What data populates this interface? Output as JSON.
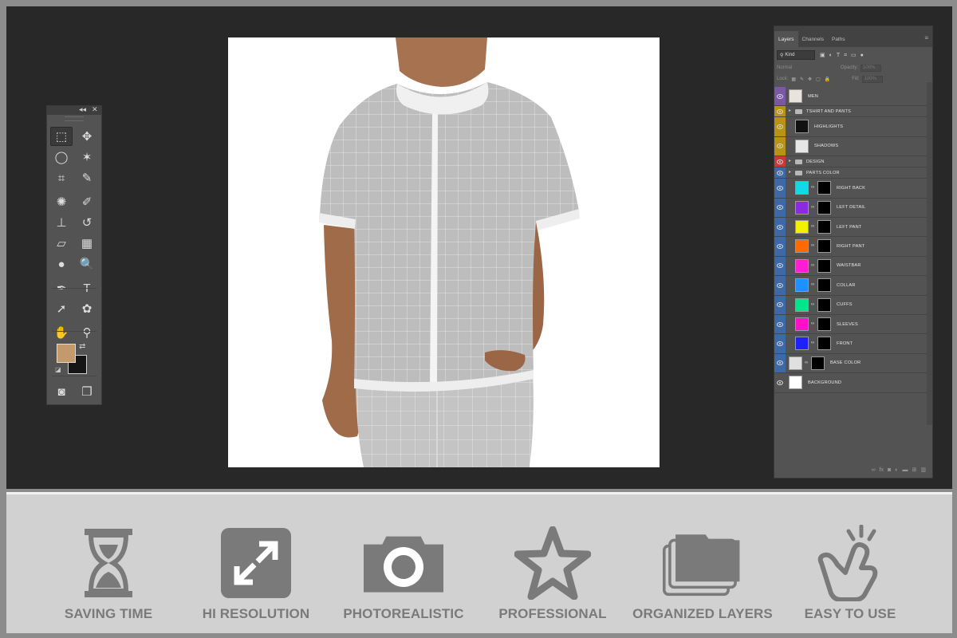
{
  "tools_panel": {
    "collapse_label": "◂◂",
    "close_label": "✕",
    "tools": [
      {
        "name": "rectangular-marquee-tool",
        "glyph": "⬚"
      },
      {
        "name": "move-tool",
        "glyph": "✥"
      },
      {
        "name": "lasso-tool",
        "glyph": "◯"
      },
      {
        "name": "magic-wand-tool",
        "glyph": "✶"
      },
      {
        "name": "crop-tool",
        "glyph": "⌗"
      },
      {
        "name": "eyedropper-tool",
        "glyph": "✎"
      },
      {
        "name": "healing-brush-tool",
        "glyph": "✺"
      },
      {
        "name": "brush-tool",
        "glyph": "✐"
      },
      {
        "name": "clone-stamp-tool",
        "glyph": "⊥"
      },
      {
        "name": "history-brush-tool",
        "glyph": "↺"
      },
      {
        "name": "eraser-tool",
        "glyph": "▱"
      },
      {
        "name": "gradient-tool",
        "glyph": "▦"
      },
      {
        "name": "blur-tool",
        "glyph": "●"
      },
      {
        "name": "dodge-tool",
        "glyph": "🔍"
      },
      {
        "name": "pen-tool",
        "glyph": "✒"
      },
      {
        "name": "type-tool",
        "glyph": "T"
      },
      {
        "name": "path-selection-tool",
        "glyph": "➚"
      },
      {
        "name": "custom-shape-tool",
        "glyph": "✿"
      },
      {
        "name": "hand-tool",
        "glyph": "✋"
      },
      {
        "name": "zoom-tool",
        "glyph": "⚲"
      },
      {
        "name": "quick-mask-button",
        "glyph": "◙"
      },
      {
        "name": "screen-mode-button",
        "glyph": "❐"
      }
    ],
    "foreground_color": "#c49a6c",
    "background_color": "#151515"
  },
  "layers_panel": {
    "tabs": [
      "Layers",
      "Channels",
      "Paths"
    ],
    "filter_kind": "Kind",
    "blend_mode": "Normal",
    "opacity_label": "Opacity:",
    "opacity_value": "100%",
    "lock_label": "Lock:",
    "fill_label": "Fill:",
    "fill_value": "100%",
    "layers": [
      {
        "name": "MEN",
        "type": "layer",
        "indent": 0,
        "color": "#7a58a6",
        "thumb": "#e8e3dd",
        "mask": false,
        "visible": true
      },
      {
        "name": "TSHIRT AND PANTS",
        "type": "group",
        "indent": 0,
        "color": "#b89413",
        "visible": true
      },
      {
        "name": "HIGHLIGHTS",
        "type": "layer",
        "indent": 1,
        "color": "#b89413",
        "thumb": "#111111",
        "mask": false,
        "visible": true
      },
      {
        "name": "SHADOWS",
        "type": "layer",
        "indent": 1,
        "color": "#b89413",
        "thumb": "#e6e6e6",
        "mask": false,
        "visible": true
      },
      {
        "name": "DESIGN",
        "type": "group",
        "indent": 0,
        "color": "#c83a3a",
        "visible": true
      },
      {
        "name": "PARTS COLOR",
        "type": "group",
        "indent": 0,
        "color": "#3d6aa6",
        "visible": true
      },
      {
        "name": "RIGHT BACK",
        "type": "layer",
        "indent": 1,
        "color": "#3d6aa6",
        "thumb": "#12d9e8",
        "mask": true,
        "visible": true
      },
      {
        "name": "LEFT DETAIL",
        "type": "layer",
        "indent": 1,
        "color": "#3d6aa6",
        "thumb": "#8a2be2",
        "mask": true,
        "visible": true
      },
      {
        "name": "LEFT PANT",
        "type": "layer",
        "indent": 1,
        "color": "#3d6aa6",
        "thumb": "#f2f200",
        "mask": true,
        "visible": true
      },
      {
        "name": "RIGHT PANT",
        "type": "layer",
        "indent": 1,
        "color": "#3d6aa6",
        "thumb": "#ff6a00",
        "mask": true,
        "visible": true
      },
      {
        "name": "WAISTBAR",
        "type": "layer",
        "indent": 1,
        "color": "#3d6aa6",
        "thumb": "#ff1fd0",
        "mask": true,
        "visible": true
      },
      {
        "name": "COLLAR",
        "type": "layer",
        "indent": 1,
        "color": "#3d6aa6",
        "thumb": "#1e90ff",
        "mask": true,
        "visible": true
      },
      {
        "name": "CUFFS",
        "type": "layer",
        "indent": 1,
        "color": "#3d6aa6",
        "thumb": "#00e68a",
        "mask": true,
        "visible": true
      },
      {
        "name": "SLEEVES",
        "type": "layer",
        "indent": 1,
        "color": "#3d6aa6",
        "thumb": "#ff10c8",
        "mask": true,
        "visible": true
      },
      {
        "name": "FRONT",
        "type": "layer",
        "indent": 1,
        "color": "#3d6aa6",
        "thumb": "#2020ff",
        "mask": true,
        "visible": true
      },
      {
        "name": "BASE COLOR",
        "type": "layer",
        "indent": 0,
        "color": "#3d6aa6",
        "thumb": "#e0e0e0",
        "mask": true,
        "visible": true
      },
      {
        "name": "BACKGROUND",
        "type": "layer",
        "indent": 0,
        "color": "#535353",
        "thumb": "#ffffff",
        "mask": false,
        "visible": true
      }
    ],
    "footer_icons": [
      "link-icon",
      "fx-icon",
      "mask-icon",
      "adjustment-icon",
      "folder-icon",
      "new-layer-icon",
      "trash-icon"
    ]
  },
  "features": [
    {
      "label": "SAVING TIME",
      "icon": "hourglass-icon"
    },
    {
      "label": "HI RESOLUTION",
      "icon": "expand-icon"
    },
    {
      "label": "PHOTOREALISTIC",
      "icon": "camera-icon"
    },
    {
      "label": "PROFESSIONAL",
      "icon": "star-icon"
    },
    {
      "label": "ORGANIZED LAYERS",
      "icon": "layers-icon"
    },
    {
      "label": "EASY TO USE",
      "icon": "touch-icon"
    }
  ]
}
